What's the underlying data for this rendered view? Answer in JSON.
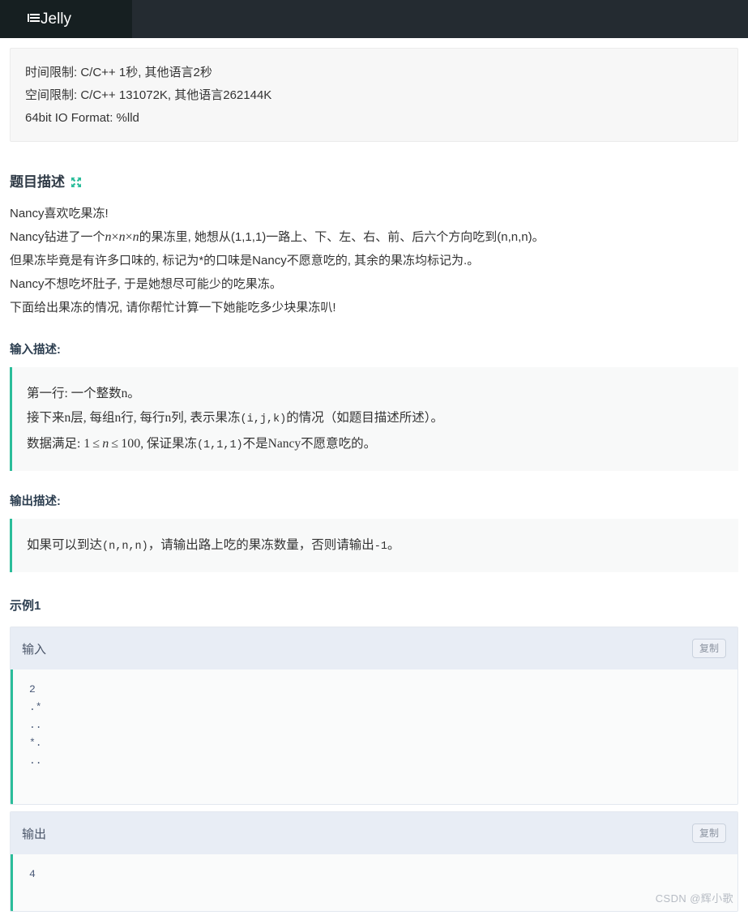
{
  "topbar": {
    "brand_label": "Jelly",
    "brand_icon": "list-lines-icon"
  },
  "limits": {
    "time_limit": "时间限制: C/C++ 1秒, 其他语言2秒",
    "memory_limit": "空间限制: C/C++ 131072K, 其他语言262144K",
    "io_format": "64bit IO Format: %lld"
  },
  "description": {
    "heading": "题目描述",
    "expand_icon": "expand-arrows-icon",
    "lines_1": "Nancy喜欢吃果冻!",
    "line2_prefix": "Nancy钻进了一个",
    "line2_math_n1": "n",
    "line2_math_times1": "×",
    "line2_math_n2": "n",
    "line2_math_times2": "×",
    "line2_math_n3": "n",
    "line2_suffix": "的果冻里, 她想从(1,1,1)一路上、下、左、右、前、后六个方向吃到(n,n,n)。",
    "lines_3": "但果冻毕竟是有许多口味的, 标记为*的口味是Nancy不愿意吃的, 其余的果冻均标记为.。",
    "lines_4": "Nancy不想吃坏肚子, 于是她想尽可能少的吃果冻。",
    "lines_5": "下面给出果冻的情况, 请你帮忙计算一下她能吃多少块果冻叭!"
  },
  "input_desc": {
    "heading": "输入描述:",
    "line1": "第一行: 一个整数n。",
    "line2_a": "接下来n层, 每组n行, 每行n列, 表示果冻",
    "line2_mono": "(i,j,k)",
    "line2_b": "的情况（如题目描述所述）。",
    "line3_a": "数据满足: ",
    "line3_math_1": "1",
    "line3_math_le1": "≤",
    "line3_math_n": "n",
    "line3_math_le2": "≤",
    "line3_math_100": "100",
    "line3_b": ", 保证果冻",
    "line3_mono": "(1,1,1)",
    "line3_c": "不是Nancy不愿意吃的。"
  },
  "output_desc": {
    "heading": "输出描述:",
    "line1_a": "如果可以到达",
    "line1_mono": "(n,n,n)",
    "line1_b": "，请输出路上吃的果冻数量，否则请输出",
    "line1_mono2": "-1",
    "line1_c": "。"
  },
  "example": {
    "title": "示例1",
    "input_label": "输入",
    "output_label": "输出",
    "copy_label": "复制",
    "input_value": "2\n.*\n..\n*.\n..",
    "output_value": "4"
  },
  "watermark": {
    "text": "CSDN @辉小歌"
  },
  "colors": {
    "topbar_dark": "#161f21",
    "topbar": "#242b31",
    "accent_teal": "#2bbd9a",
    "heading": "#2c3e50",
    "example_head_bg": "#e8edf5"
  }
}
